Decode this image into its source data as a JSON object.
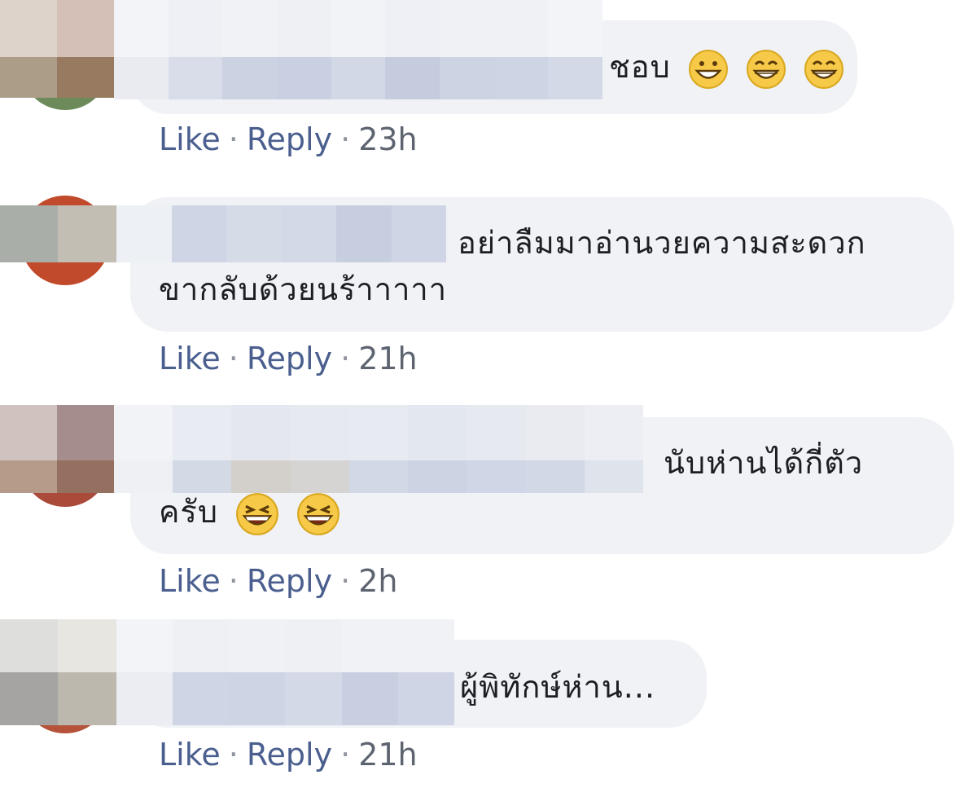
{
  "comments": [
    {
      "text_line1": "ชอบ",
      "text_line2": "",
      "actions": {
        "like": "Like",
        "reply": "Reply",
        "time": "23h"
      },
      "emojis": [
        "grinning-face-icon",
        "beaming-face-icon",
        "beaming-face-icon"
      ]
    },
    {
      "text_line1": "อย่าลืมมาอ่านวยความสะดวก",
      "text_line2": "ขากลับด้วยนร้าาาาา",
      "actions": {
        "like": "Like",
        "reply": "Reply",
        "time": "21h"
      },
      "emojis": []
    },
    {
      "text_line1": "นับห่านได้กี่ตัว",
      "text_line2": "ครับ",
      "actions": {
        "like": "Like",
        "reply": "Reply",
        "time": "2h"
      },
      "emojis": [
        "laughing-face-icon",
        "laughing-face-icon"
      ]
    },
    {
      "text_line1": "ผู้พิทักษ์ห่าน...",
      "text_line2": "",
      "actions": {
        "like": "Like",
        "reply": "Reply",
        "time": "21h"
      },
      "emojis": []
    }
  ],
  "separator": "·",
  "colors": {
    "bubble": "#f0f2f5",
    "link": "#4b5f8f",
    "emoji_face": "#f7c948"
  }
}
